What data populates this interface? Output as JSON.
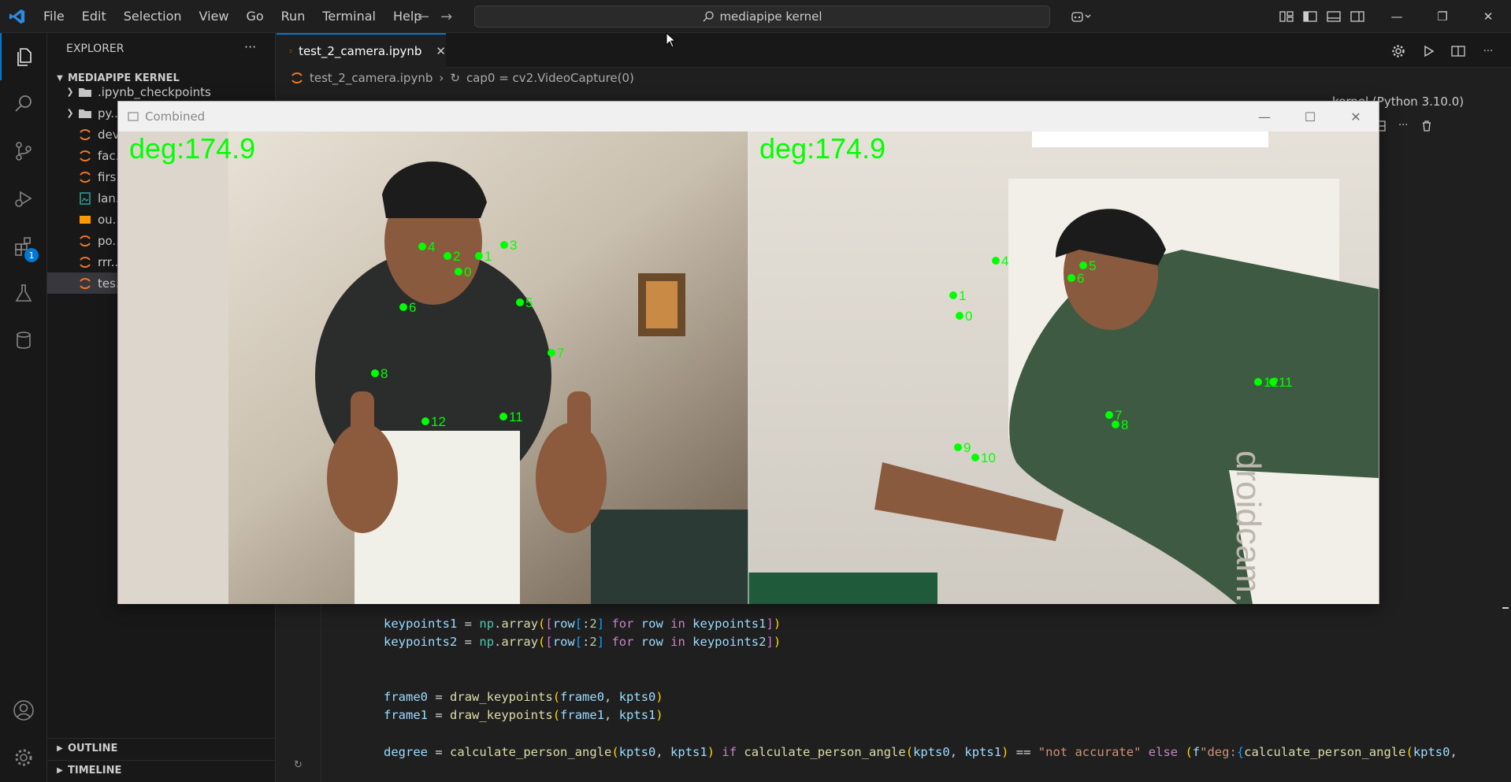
{
  "menu": [
    "File",
    "Edit",
    "Selection",
    "View",
    "Go",
    "Run",
    "Terminal",
    "Help"
  ],
  "search": {
    "text": "mediapipe kernel"
  },
  "sidebar": {
    "title": "EXPLORER",
    "section": "MEDIAPIPE KERNEL",
    "items": [
      {
        "label": ".ipynb_checkpoints",
        "type": "folder"
      },
      {
        "label": "py...",
        "type": "folder"
      },
      {
        "label": "dev...",
        "type": "notebook"
      },
      {
        "label": "fac...",
        "type": "notebook"
      },
      {
        "label": "firs...",
        "type": "notebook"
      },
      {
        "label": "lan...",
        "type": "image"
      },
      {
        "label": "ou...",
        "type": "video"
      },
      {
        "label": "po...",
        "type": "notebook"
      },
      {
        "label": "rrr...",
        "type": "notebook"
      },
      {
        "label": "tes...",
        "type": "notebook"
      }
    ],
    "outline": "OUTLINE",
    "timeline": "TIMELINE",
    "extensions_badge": "1"
  },
  "editor": {
    "tab_label": "test_2_camera.ipynb",
    "breadcrumb_file": "test_2_camera.ipynb",
    "breadcrumb_symbol": "cap0 = cv2.VideoCapture(0)",
    "kernel": "kernel (Python 3.10.0)"
  },
  "code_lines": [
    "keypoints1 = np.array([row[:2] for row in keypoints1])",
    "keypoints2 = np.array([row[:2] for row in keypoints2])",
    "frame0 = draw_keypoints(frame0, kpts0)",
    "frame1 = draw_keypoints(frame1, kpts1)",
    "degree = calculate_person_angle(kpts0, kpts1) if calculate_person_angle(kpts0, kpts1) == \"not accurate\" else (f\"deg:{calculate_person_angle(kpts0,"
  ],
  "cv_window": {
    "title": "Combined",
    "left_label": "deg:174.9",
    "right_label": "deg:174.9",
    "watermark": "droidcam.app",
    "left_points": [
      "0",
      "1",
      "2",
      "3",
      "4",
      "5",
      "6",
      "7",
      "8",
      "11",
      "12"
    ],
    "right_points": [
      "0",
      "1",
      "4",
      "5",
      "6",
      "7",
      "8",
      "9",
      "10",
      "11",
      "12"
    ],
    "point_color": "#00ff00"
  }
}
